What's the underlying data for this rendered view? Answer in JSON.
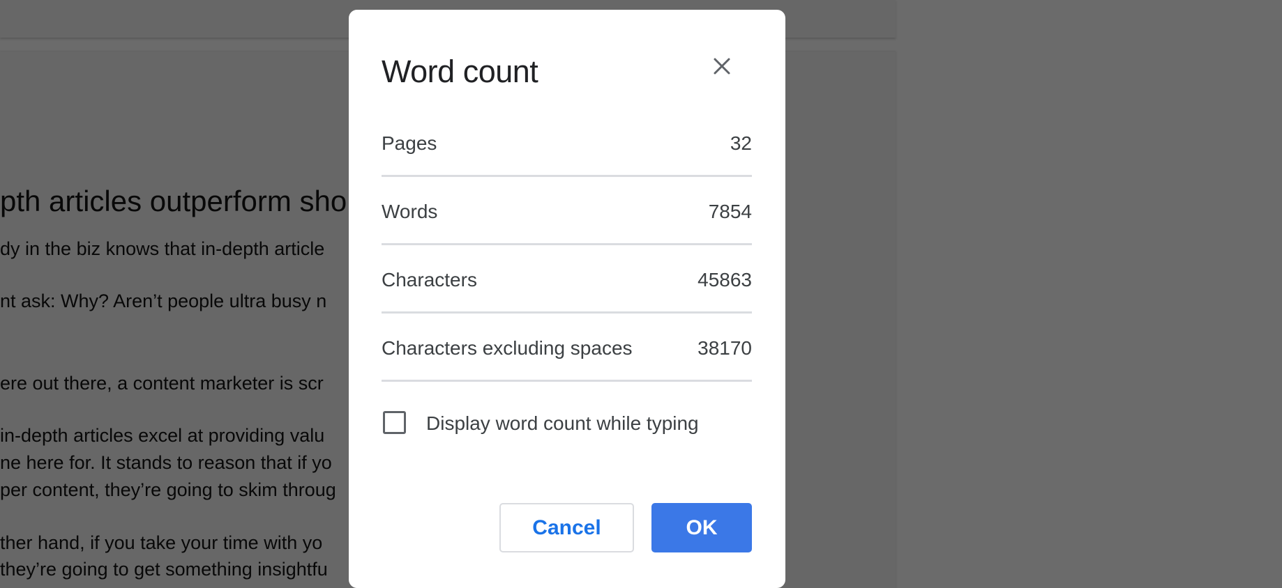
{
  "background_document": {
    "visible_lines": [
      "pth articles outperform shor",
      "dy in the biz knows that in-depth article",
      "nt ask: Why? Aren’t people ultra busy n",
      "ere out there, a content marketer is scr",
      "in-depth articles excel at providing valu",
      "ne here for. It stands to reason that if yo",
      "per content, they’re going to skim throug",
      "ther hand, if you take your time with yo",
      "they’re going to get something insightfu"
    ]
  },
  "dialog": {
    "title": "Word count",
    "close_icon": "close-icon",
    "stats": [
      {
        "label": "Pages",
        "value": "32"
      },
      {
        "label": "Words",
        "value": "7854"
      },
      {
        "label": "Characters",
        "value": "45863"
      },
      {
        "label": "Characters excluding spaces",
        "value": "38170"
      }
    ],
    "checkbox": {
      "label": "Display word count while typing",
      "checked": false
    },
    "buttons": {
      "cancel": "Cancel",
      "ok": "OK"
    }
  },
  "colors": {
    "overlay": "#6b6b6b",
    "dialog_background": "#ffffff",
    "primary_button": "#3b78e7",
    "link_blue": "#1a73e8",
    "text": "#3c4043",
    "divider": "#dadce0"
  }
}
